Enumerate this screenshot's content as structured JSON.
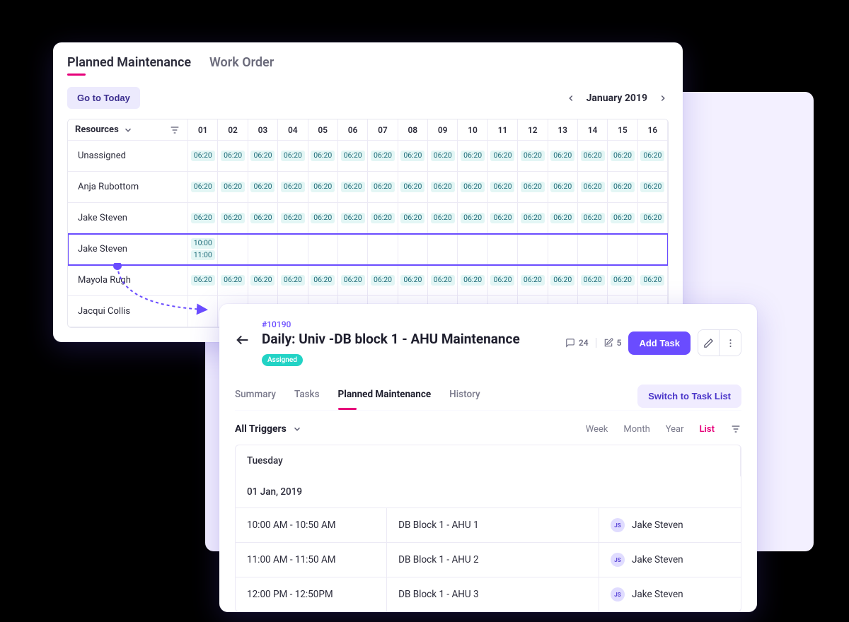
{
  "top_tabs": {
    "planned": "Planned Maintenance",
    "work_order": "Work Order"
  },
  "scheduler": {
    "today_btn": "Go to Today",
    "month_label": "January 2019",
    "resources_label": "Resources",
    "days": [
      "01",
      "02",
      "03",
      "04",
      "05",
      "06",
      "07",
      "08",
      "09",
      "10",
      "11",
      "12",
      "13",
      "14",
      "15",
      "16"
    ],
    "default_time": "06:20",
    "rows": [
      {
        "name": "Unassigned",
        "type": "default"
      },
      {
        "name": "Anja Rubottom",
        "type": "default"
      },
      {
        "name": "Jake Steven",
        "type": "default"
      },
      {
        "name": "Jake Steven",
        "type": "highlight",
        "times_col1": [
          "10:00",
          "11:00"
        ]
      },
      {
        "name": "Mayola Rugh",
        "type": "default"
      },
      {
        "name": "Jacqui Collis",
        "type": "empty"
      }
    ]
  },
  "detail": {
    "id": "#10190",
    "title": "Daily: Univ -DB block 1 - AHU Maintenance",
    "status": "Assigned",
    "meta": {
      "comments": "24",
      "attachments": "5"
    },
    "add_task": "Add Task",
    "subtabs": {
      "summary": "Summary",
      "tasks": "Tasks",
      "planned": "Planned Maintenance",
      "history": "History"
    },
    "switch_btn": "Switch to Task List",
    "triggers_label": "All Triggers",
    "views": {
      "week": "Week",
      "month": "Month",
      "year": "Year",
      "list": "List"
    },
    "table": {
      "day_header": "Tuesday",
      "date_header": "01 Jan, 2019",
      "rows": [
        {
          "time": "10:00 AM - 10:50 AM",
          "task": "DB Block 1 - AHU 1",
          "assignee": "Jake Steven",
          "initials": "JS"
        },
        {
          "time": "11:00 AM - 11:50 AM",
          "task": "DB Block 1 - AHU 2",
          "assignee": "Jake Steven",
          "initials": "JS"
        },
        {
          "time": "12:00 PM - 12:50PM",
          "task": "DB Block 1 - AHU 3",
          "assignee": "Jake Steven",
          "initials": "JS"
        }
      ]
    }
  }
}
